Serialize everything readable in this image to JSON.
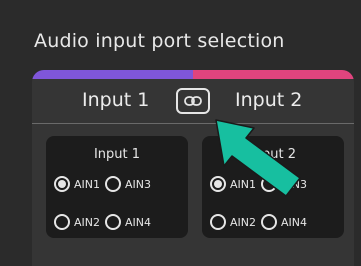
{
  "section": {
    "title": "Audio input port selection"
  },
  "colors": {
    "accent_left": "#7f56d9",
    "accent_right": "#e0447e",
    "annotation_arrow": "#17bfa0"
  },
  "header": {
    "input1_label": "Input 1",
    "input2_label": "Input 2",
    "link_icon": "link-icon"
  },
  "groups": [
    {
      "title": "Input 1",
      "options": [
        {
          "label": "AIN1",
          "selected": true
        },
        {
          "label": "AIN3",
          "selected": false
        },
        {
          "label": "AIN2",
          "selected": false
        },
        {
          "label": "AIN4",
          "selected": false
        }
      ]
    },
    {
      "title": "Input 2",
      "options": [
        {
          "label": "AIN1",
          "selected": true
        },
        {
          "label": "AIN3",
          "selected": false
        },
        {
          "label": "AIN2",
          "selected": false
        },
        {
          "label": "AIN4",
          "selected": false
        }
      ]
    }
  ]
}
